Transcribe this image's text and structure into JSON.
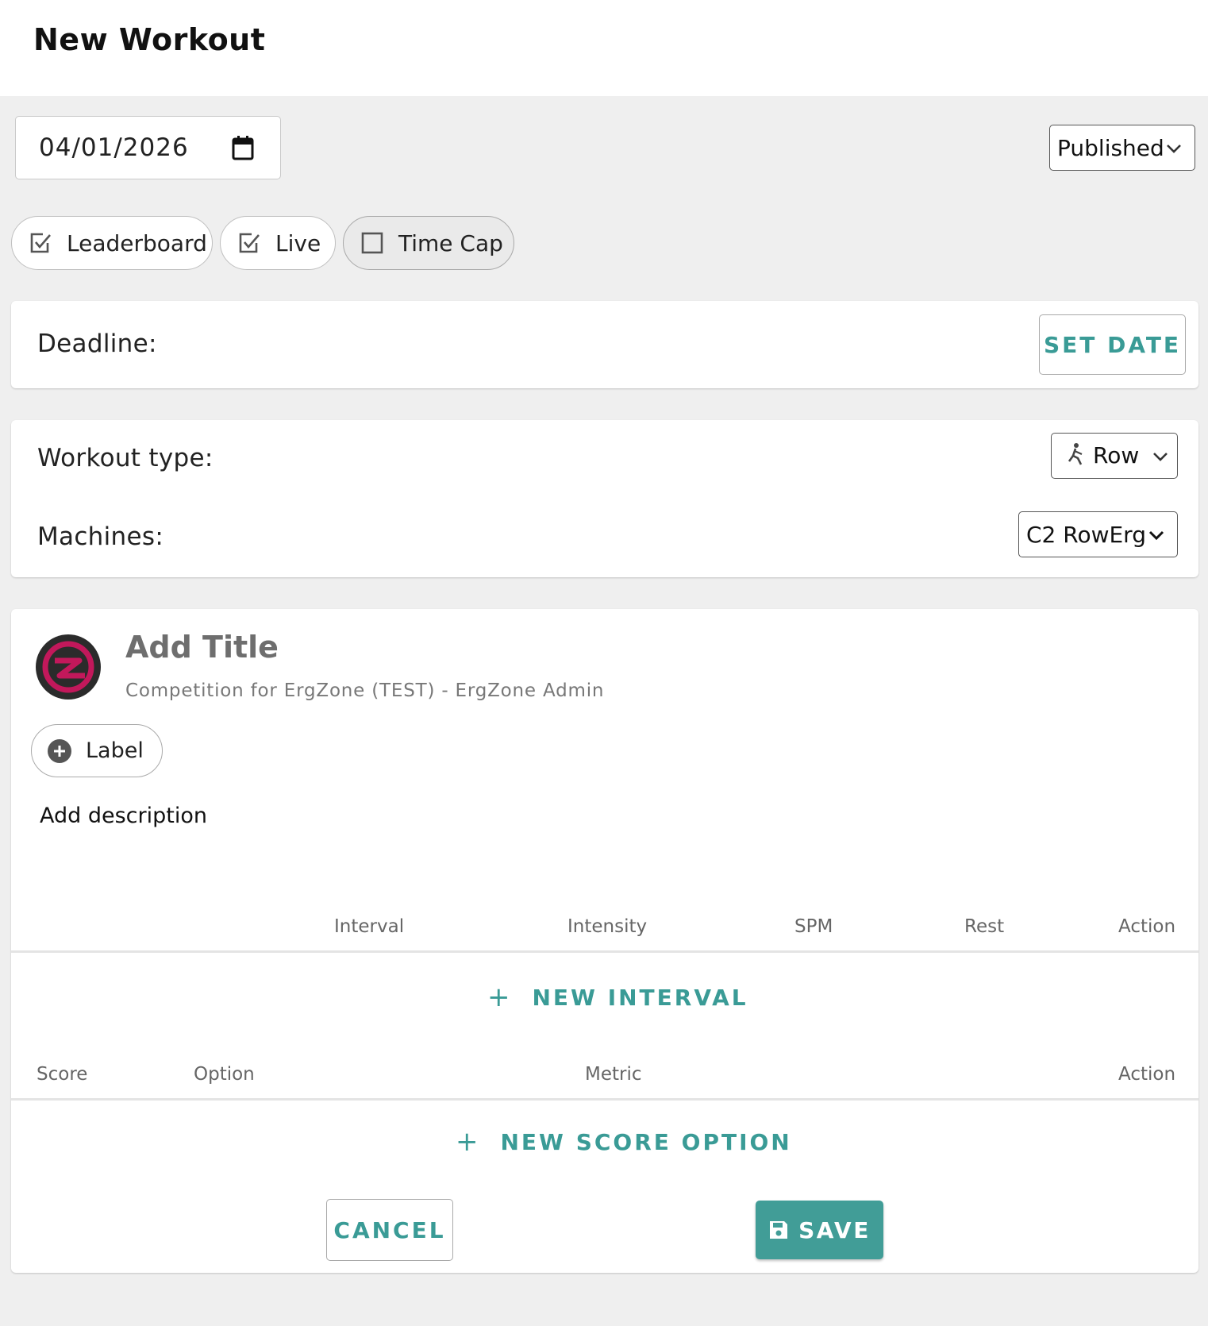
{
  "header": {
    "title": "New Workout"
  },
  "date": {
    "value": "04/01/2026",
    "icon": "calendar-icon"
  },
  "status": {
    "selected": "Published",
    "icon": "chevron-down-icon"
  },
  "toggles": [
    {
      "label": "Leaderboard",
      "checked": true
    },
    {
      "label": "Live",
      "checked": true
    },
    {
      "label": "Time Cap",
      "checked": false
    }
  ],
  "deadline": {
    "label": "Deadline:",
    "button": "SET DATE"
  },
  "workout": {
    "type_label": "Workout type:",
    "type_value": "Row",
    "type_icon": "rowing-icon",
    "machines_label": "Machines:",
    "machines_value": "C2 RowErg"
  },
  "details": {
    "title_placeholder": "Add Title",
    "subtitle": "Competition for ErgZone (TEST) - ErgZone Admin",
    "label_button": "Label",
    "description_placeholder": "Add description"
  },
  "intervals": {
    "columns": [
      "Interval",
      "Intensity",
      "SPM",
      "Rest",
      "Action"
    ],
    "add_button": "NEW INTERVAL"
  },
  "scores": {
    "columns": [
      "Score",
      "Option",
      "Metric",
      "Action"
    ],
    "add_button": "NEW SCORE OPTION"
  },
  "actions": {
    "cancel": "CANCEL",
    "save": "SAVE"
  },
  "colors": {
    "accent": "#419d97",
    "brand_ring": "#c2185b",
    "avatar_bg": "#2b2b2b"
  }
}
